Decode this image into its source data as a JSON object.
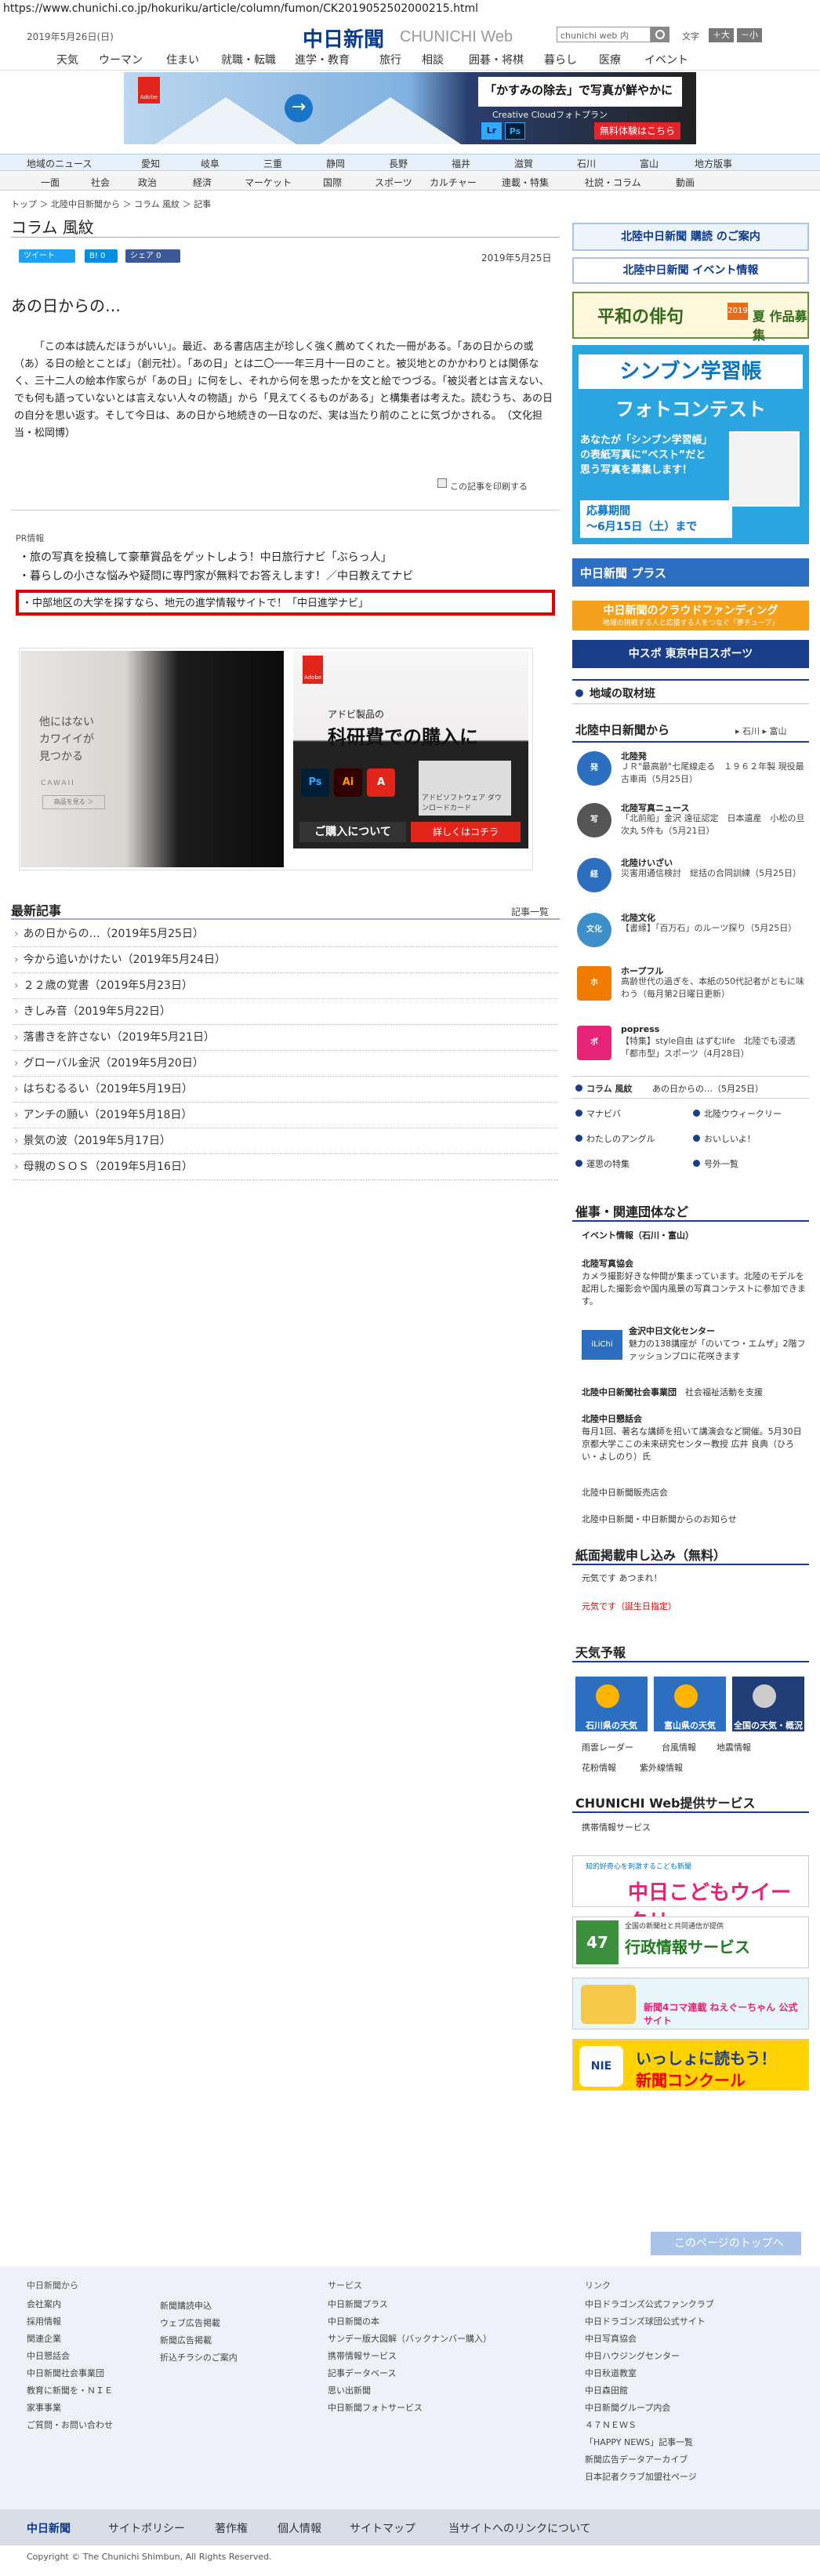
{
  "browser": {
    "url": "https://www.chunichi.co.jp/hokuriku/article/column/fumon/CK2019052502000215.html"
  },
  "header": {
    "date": "2019年5月26日(日)",
    "logo": "中日新聞",
    "logo_sub": "CHUNICHI Web",
    "search_placeholder": "chunichi web 内",
    "font_label": "文字",
    "font_large": "＋大",
    "font_small": "－小"
  },
  "gnav": [
    "天気",
    "ウーマン",
    "住まい",
    "就職・転職",
    "進学・教育",
    "旅行",
    "相談",
    "囲碁・将棋",
    "暮らし",
    "医療",
    "イベント"
  ],
  "ad_top": {
    "brand": "Adobe",
    "headline": "「かすみの除去」で写真が鮮やかに",
    "sub": "Creative Cloudフォトプラン",
    "lr": "Lr",
    "ps": "Ps",
    "buy": "無料体験はこちら"
  },
  "rnav": [
    "地域のニュース",
    "愛知",
    "岐阜",
    "三重",
    "静岡",
    "長野",
    "福井",
    "滋賀",
    "石川",
    "富山",
    "地方版事"
  ],
  "snav": [
    "一面",
    "社会",
    "政治",
    "経済",
    "マーケット",
    "国際",
    "スポーツ",
    "カルチャー",
    "連載・特集",
    "社説・コラム",
    "動画"
  ],
  "breadcrumb": "トップ ＞ 北陸中日新聞から ＞ コラム 風紋 ＞ 記事",
  "section": "コラム 風紋",
  "social": {
    "tweet": "ツイート",
    "hatena": "B! 0",
    "share": "シェア 0"
  },
  "pub_date": "2019年5月25日",
  "article": {
    "title": "あの日からの…",
    "body": "「この本は読んだほうがいい」。最近、ある書店店主が珍しく強く薦めてくれた一冊がある。「あの日からの或（あ）る日の絵とことば」（創元社）。「あの日」とは二〇一一年三月十一日のこと。被災地とのかかわりとは関係なく、三十二人の絵本作家らが「あの日」に何をし、それから何を思ったかを文と絵でつづる。「被災者とは言えない、でも何も語っていないとは言えない人々の物語」から「見えてくるものがある」と構集者は考えた。読むうち、あの日の自分を思い返す。そして今日は、あの日から地続きの一日なのだ、実は当たり前のことに気づかされる。　（文化担当・松岡博）",
    "print": "この記事を印刷する"
  },
  "pr": {
    "label": "PR情報",
    "items": [
      "旅の写真を投稿して豪華賞品をゲットしよう！中日旅行ナビ「ぶらっ人」",
      "暮らしの小さな悩みや疑問に専門家が無料でお答えします！／中日教えてナビ",
      "中部地区の大学を探すなら、地元の進学情報サイトで！「中日進学ナビ」"
    ]
  },
  "ad_mid": {
    "a_text": "他にはない\nカワイイが\n見つかる",
    "a_brand": "CAWAII",
    "a_btn": "商品を見る ＞",
    "b_brand": "Adobe",
    "b_t1": "アドビ製品の",
    "b_t2": "科研費での購入に",
    "b_card": "アドビソフトウェア ダウンロードカード",
    "b_f1": "ご購入について",
    "b_f2": "詳しくはコチラ"
  },
  "latest": {
    "title": "最新記事",
    "all": "記事一覧",
    "items": [
      "あの日からの…（2019年5月25日）",
      "今から追いかけたい（2019年5月24日）",
      "２２歳の覚書（2019年5月23日）",
      "きしみ音（2019年5月22日）",
      "落書きを許さない（2019年5月21日）",
      "グローバル金沢（2019年5月20日）",
      "はちむるるい（2019年5月19日）",
      "アンチの願い（2019年5月18日）",
      "景気の波（2019年5月17日）",
      "母親のＳＯＳ（2019年5月16日）"
    ]
  },
  "right": {
    "subscribe": "北陸中日新聞 購読 のご案内",
    "event": "北陸中日新聞 イベント情報",
    "haiku": {
      "t": "平和の俳句",
      "badge": "2019",
      "s": "夏 作品募集"
    },
    "shinbun": {
      "h1": "シンブン学習帳",
      "h2": "フォトコンテスト",
      "m": "あなたが「シンブン学習帳」の表紙写真に“ベスト”だと思う写真を募集します！",
      "period": "応募期間\n～6月15日（土）まで"
    },
    "plus": "中日新聞 プラス",
    "cloud": "中日新聞のクラウドファンディング",
    "cloud_sub": "地域の挑戦する人と応援する人をつなぐ「夢チューブ」",
    "chusp": "中スポ 東京中日スポーツ",
    "kaitai": "地域の取材班",
    "hoku": {
      "title": "北陸中日新聞から",
      "links": "▸ 石川 ▸ 富山"
    },
    "news": [
      {
        "icon": "発",
        "color": "#2c6fc0",
        "t": "北陸発",
        "d": "ＪＲ\"最高齢\"七尾線走る　１９６２年製 現役最古車両（5月25日）"
      },
      {
        "icon": "写",
        "color": "#555",
        "t": "北陸写真ニュース",
        "d": "「北前船」金沢 遠征認定　日本遺産　小松の旦次丸 5件も（5月21日）"
      },
      {
        "icon": "経",
        "color": "#2c6fc0",
        "t": "北陸けいざい",
        "d": "災害用通信検討　総括の合同訓練（5月25日）"
      },
      {
        "icon": "文化",
        "color": "#3c8fc8",
        "t": "北陸文化",
        "d": "【書縁】「百万石」のルーツ探り（5月25日）"
      },
      {
        "icon": "ホ",
        "color": "#f07c00",
        "t": "ホープフル",
        "d": "高齢世代の過ぎを、本紙の50代記者がともに味わう（毎月第2日曜日更新）"
      },
      {
        "icon": "ポ",
        "color": "#e72378",
        "t": "popress",
        "d": "【特集】style自由 はずむlife　北陸でも浸透「都市型」スポーツ（4月28日）"
      }
    ],
    "column_row": {
      "label": "コラム 風紋",
      "latest": "あの日からの…（5月25日）"
    },
    "col_links": [
      "マナビバ",
      "北陸ウウィークリー",
      "わたしのアングル",
      "おいしいよ！",
      "運思の特集",
      "号外一覧"
    ],
    "events": {
      "title": "催事・関連団体など",
      "items": [
        {
          "t": "イベント情報（石川・富山）",
          "d": ""
        },
        {
          "t": "北陸写真協会",
          "d": "カメラ撮影好きな仲間が集まっています。北陸のモデルを起用した撮影会や国内風景の写真コンテストに参加できます。"
        },
        {
          "t": "金沢中日文化センター",
          "d": "魅力の138講座が「のいてつ・エムザ」2階ファッションプロに花咲きます"
        },
        {
          "t": "北陸中日新聞社会事業団",
          "d": "社会福祉活動を支援"
        },
        {
          "t": "北陸中日懇話会",
          "d": "毎月1回、著名な講師を招いて講演会など開催。5月30日 京都大学ここの未来研究センター教授 広井 良典（ひろい・よしのり）氏"
        },
        {
          "t": "北陸中日新聞販売店会",
          "d": ""
        },
        {
          "t": "北陸中日新聞・中日新聞からのお知らせ",
          "d": ""
        }
      ]
    },
    "print_req": {
      "title": "紙面掲載申し込み（無料）",
      "items": [
        "元気です あつまれ！",
        "元気です（誕生日指定）"
      ]
    },
    "weather": {
      "title": "天気予報",
      "boxes": [
        "石川県の天気",
        "富山県の天気",
        "全国の天気・概況"
      ],
      "links": [
        "雨雲レーダー",
        "台風情報",
        "地震情報",
        "花粉情報",
        "紫外線情報"
      ]
    },
    "services": {
      "title": "CHUNICHI Web提供サービス",
      "link": "携帯情報サービス"
    },
    "banners": {
      "kodomo_s": "知的好奇心を刺激するこども新聞",
      "kodomo": "中日こどもウイークリー",
      "gyosei_n": "47",
      "gyosei_s": "全国の新聞社と共同通信が提供",
      "gyosei": "行政情報サービス",
      "yonkoma": "新聞4コマ連載 ねえぐーちゃん 公式サイト",
      "nie_l": "NIE",
      "nie1": "いっしょに読もう！",
      "nie2": "新聞コンクール"
    }
  },
  "totop": "このページのトップへ",
  "footer": {
    "col1": {
      "title": "中日新聞から",
      "items": [
        "会社案内",
        "採用情報",
        "関連企業",
        "中日懇話会",
        "中日新聞社会事業団",
        "教育に新聞を・ＮＩＥ",
        "家事事業",
        "ご質問・お問い合わせ"
      ]
    },
    "col2": {
      "title": "",
      "items": [
        "新聞購読申込",
        "ウェブ広告掲載",
        "新聞広告掲載",
        "折込チラシのご案内"
      ]
    },
    "col3": {
      "title": "サービス",
      "items": [
        "中日新聞プラス",
        "中日新聞の本",
        "サンデー版大図解（バックナンバー購入）",
        "携帯情報サービス",
        "記事データベース",
        "思い出新聞",
        "中日新聞フォトサービス"
      ]
    },
    "col4": {
      "title": "リンク",
      "items": [
        "中日ドラゴンズ公式ファンクラブ",
        "中日ドラゴンズ球団公式サイト",
        "中日写真協会",
        "中日ハウジングセンター",
        "中日秋道教室",
        "中日森田館",
        "中日新聞グループ内会",
        "４７ＮＥＷＳ",
        "「HAPPY NEWS」記事一覧",
        "新聞広告データアーカイブ",
        "日本記者クラブ加盟社ページ"
      ]
    }
  },
  "fbar": [
    "中日新聞",
    "サイトポリシー",
    "著作権",
    "個人情報",
    "サイトマップ",
    "当サイトへのリンクについて"
  ],
  "copyright": "Copyright © The Chunichi Shimbun, All Rights Reserved."
}
